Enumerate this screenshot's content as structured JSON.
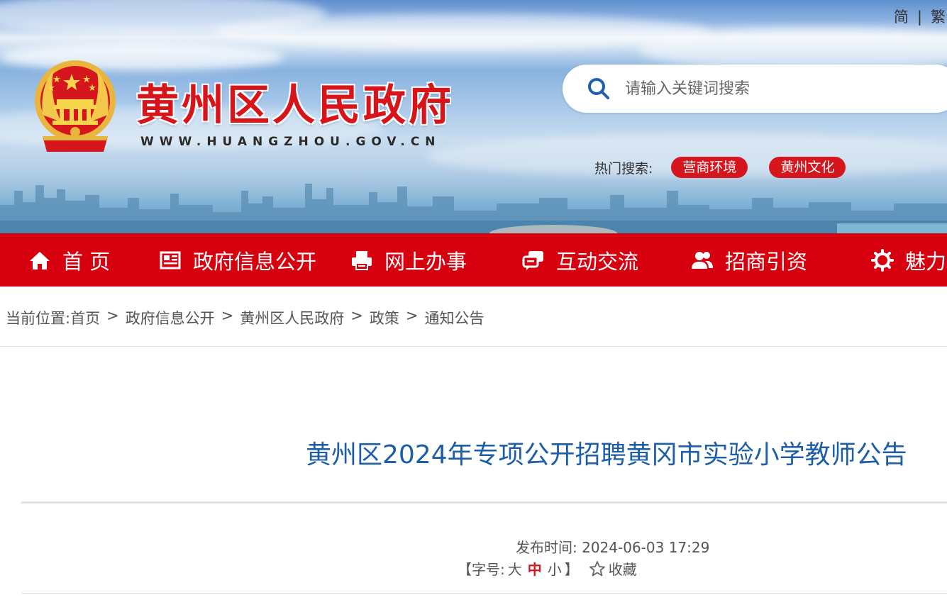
{
  "header": {
    "lang_simplified": "简",
    "lang_traditional": "繁",
    "site_title": "黄州区人民政府",
    "site_url": "WWW.HUANGZHOU.GOV.CN",
    "search_placeholder": "请输入关键词搜索",
    "hot_search_label": "热门搜索:",
    "hot_tags": [
      "营商环境",
      "黄州文化"
    ]
  },
  "nav": {
    "items": [
      {
        "label": "首 页",
        "icon": "home-icon"
      },
      {
        "label": "政府信息公开",
        "icon": "newspaper-icon"
      },
      {
        "label": "网上办事",
        "icon": "printer-icon"
      },
      {
        "label": "互动交流",
        "icon": "chat-icon"
      },
      {
        "label": "招商引资",
        "icon": "users-icon"
      },
      {
        "label": "魅力",
        "icon": "gear-icon"
      }
    ]
  },
  "breadcrumb": {
    "prefix": "当前位置:",
    "items": [
      "首页",
      "政府信息公开",
      "黄州区人民政府",
      "政策",
      "通知公告"
    ]
  },
  "article": {
    "title": "黄州区2024年专项公开招聘黄冈市实验小学教师公告",
    "publish_label": "发布时间:",
    "publish_time": "2024-06-03 17:29",
    "font_size_label": "【字号:",
    "size_large": "大",
    "size_medium": "中",
    "size_small": "小",
    "font_size_end": "】",
    "favorite_label": "收藏"
  },
  "colors": {
    "brand_red": "#d7000f",
    "title_blue": "#1c5ea8"
  }
}
